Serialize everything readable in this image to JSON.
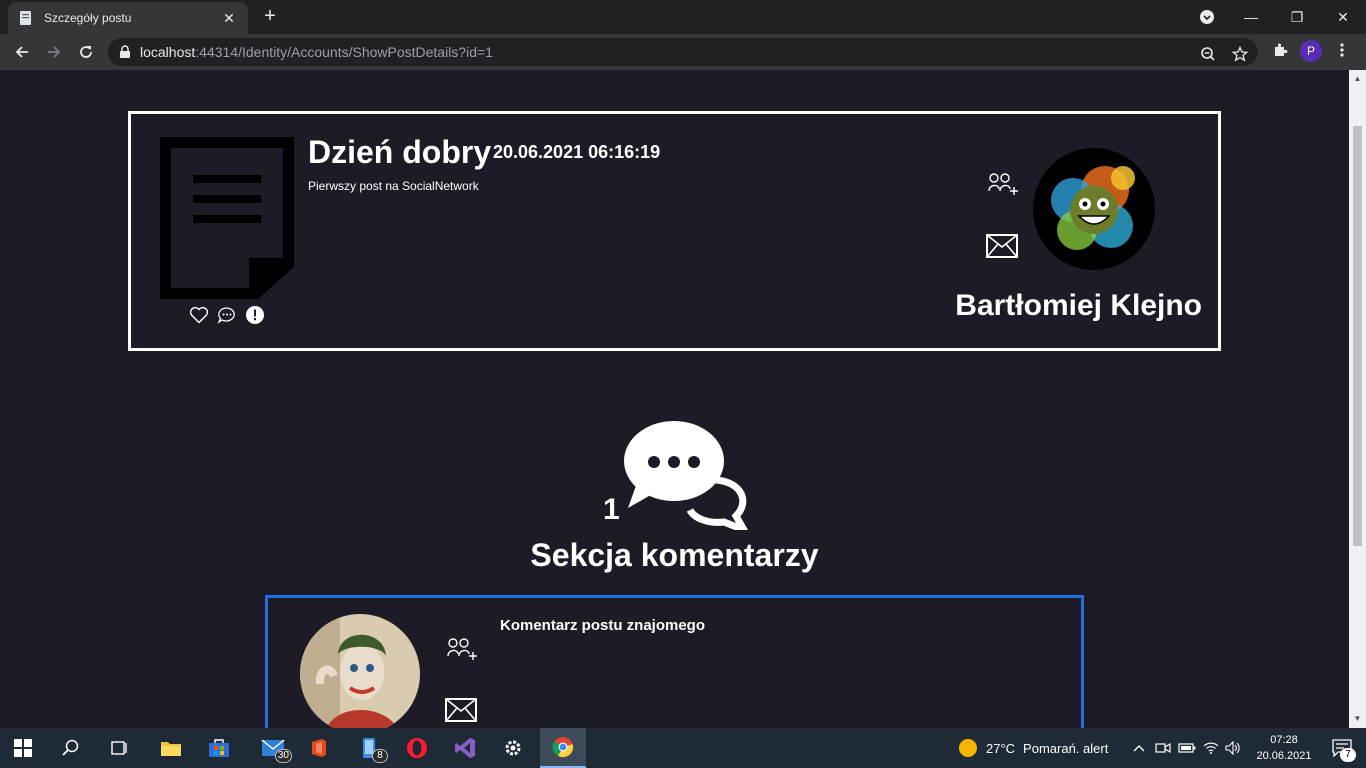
{
  "browser": {
    "tab_title": "Szczegóły postu",
    "tab_close": "✕",
    "new_tab": "+",
    "url_host": "localhost",
    "url_rest": ":44314/Identity/Accounts/ShowPostDetails?id=1",
    "profile_initial": "P",
    "min": "—",
    "restore": "❐",
    "close": "✕"
  },
  "post": {
    "title": "Dzień dobry",
    "date": "20.06.2021 06:16:19",
    "body": "Pierwszy post na SocialNetwork",
    "author_name": "Bartłomiej Klejno",
    "actions": [
      "heart-icon",
      "comment-icon",
      "report-icon"
    ]
  },
  "comments": {
    "count": "1",
    "heading": "Sekcja komentarzy",
    "items": [
      {
        "text": "Komentarz postu znajomego"
      }
    ]
  },
  "taskbar": {
    "mail_badge": "30",
    "phone_badge": "8",
    "weather_temp": "27°C",
    "weather_text": "Pomarań. alert",
    "time": "07:28",
    "date": "20.06.2021",
    "notif_count": "7"
  },
  "colors": {
    "page_bg": "#1d1c26",
    "comment_border": "#1f6fe5",
    "card_border": "#ffffff"
  }
}
